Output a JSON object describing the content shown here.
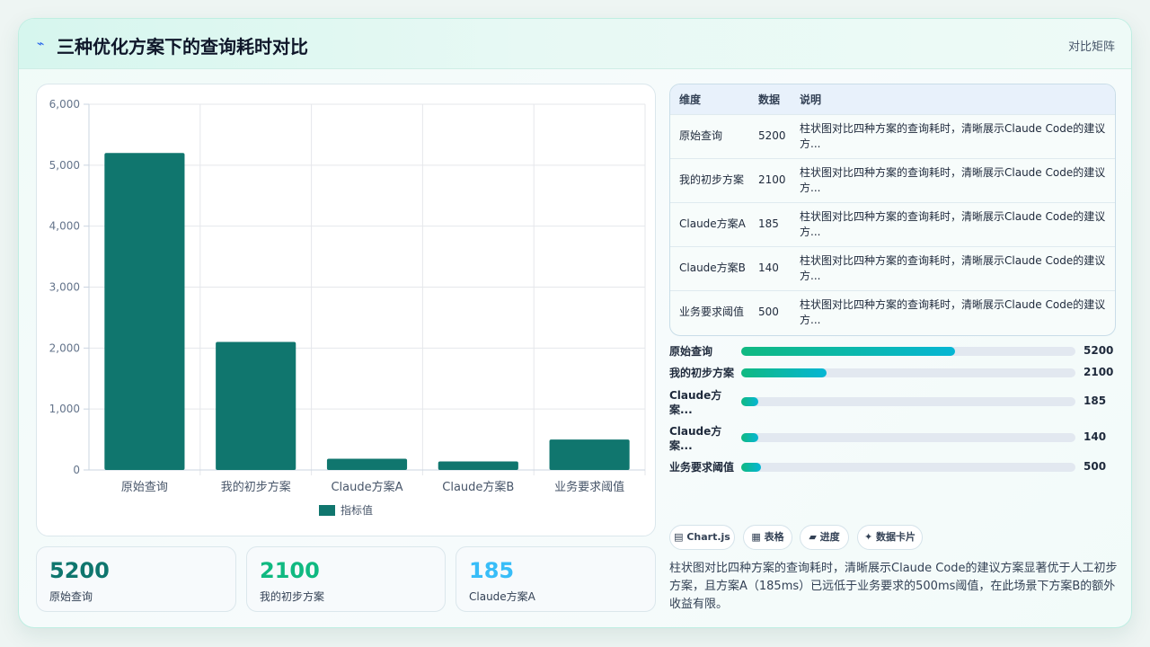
{
  "header": {
    "icon": "lightning-icon",
    "title": "三种优化方案下的查询耗时对比",
    "right_label": "对比矩阵"
  },
  "chart_data": {
    "type": "bar",
    "categories": [
      "原始查询",
      "我的初步方案",
      "Claude方案A",
      "Claude方案B",
      "业务要求阈值"
    ],
    "series": [
      {
        "name": "指标值",
        "values": [
          5200,
          2100,
          185,
          140,
          500
        ],
        "color": "#10766e"
      }
    ],
    "yticks": [
      "0",
      "1,000",
      "2,000",
      "3,000",
      "4,000",
      "5,000",
      "6,000"
    ],
    "ylim": [
      0,
      6000
    ],
    "grid": true,
    "legend_position": "bottom"
  },
  "stats": [
    {
      "value": "5200",
      "label": "原始查询",
      "color": "#0f766e"
    },
    {
      "value": "2100",
      "label": "我的初步方案",
      "color": "#10b981"
    },
    {
      "value": "185",
      "label": "Claude方案A",
      "color": "#38bdf8"
    }
  ],
  "table": {
    "headers": [
      "维度",
      "数据",
      "说明"
    ],
    "rows": [
      {
        "dim": "原始查询",
        "value": "5200",
        "desc": "柱状图对比四种方案的查询耗时，清晰展示Claude Code的建议方..."
      },
      {
        "dim": "我的初步方案",
        "value": "2100",
        "desc": "柱状图对比四种方案的查询耗时，清晰展示Claude Code的建议方..."
      },
      {
        "dim": "Claude方案A",
        "value": "185",
        "desc": "柱状图对比四种方案的查询耗时，清晰展示Claude Code的建议方..."
      },
      {
        "dim": "Claude方案B",
        "value": "140",
        "desc": "柱状图对比四种方案的查询耗时，清晰展示Claude Code的建议方..."
      },
      {
        "dim": "业务要求阈值",
        "value": "500",
        "desc": "柱状图对比四种方案的查询耗时，清晰展示Claude Code的建议方..."
      }
    ]
  },
  "progress": [
    {
      "label": "原始查询",
      "value": "5200",
      "fraction": 0.64
    },
    {
      "label": "我的初步方案",
      "value": "2100",
      "fraction": 0.255
    },
    {
      "label": "Claude方案...",
      "value": "185",
      "fraction": 0.05
    },
    {
      "label": "Claude方案...",
      "value": "140",
      "fraction": 0.05
    },
    {
      "label": "业务要求阈值",
      "value": "500",
      "fraction": 0.06
    }
  ],
  "chips": [
    {
      "icon": "chart-icon",
      "label": "▤ Chart.js"
    },
    {
      "icon": "table-icon",
      "label": "▦ 表格"
    },
    {
      "icon": "progress-icon",
      "label": "▰ 进度"
    },
    {
      "icon": "sparkle-icon",
      "label": "✦ 数据卡片"
    }
  ],
  "summary": "柱状图对比四种方案的查询耗时，清晰展示Claude Code的建议方案显著优于人工初步方案，且方案A（185ms）已远低于业务要求的500ms阈值，在此场景下方案B的额外收益有限。"
}
